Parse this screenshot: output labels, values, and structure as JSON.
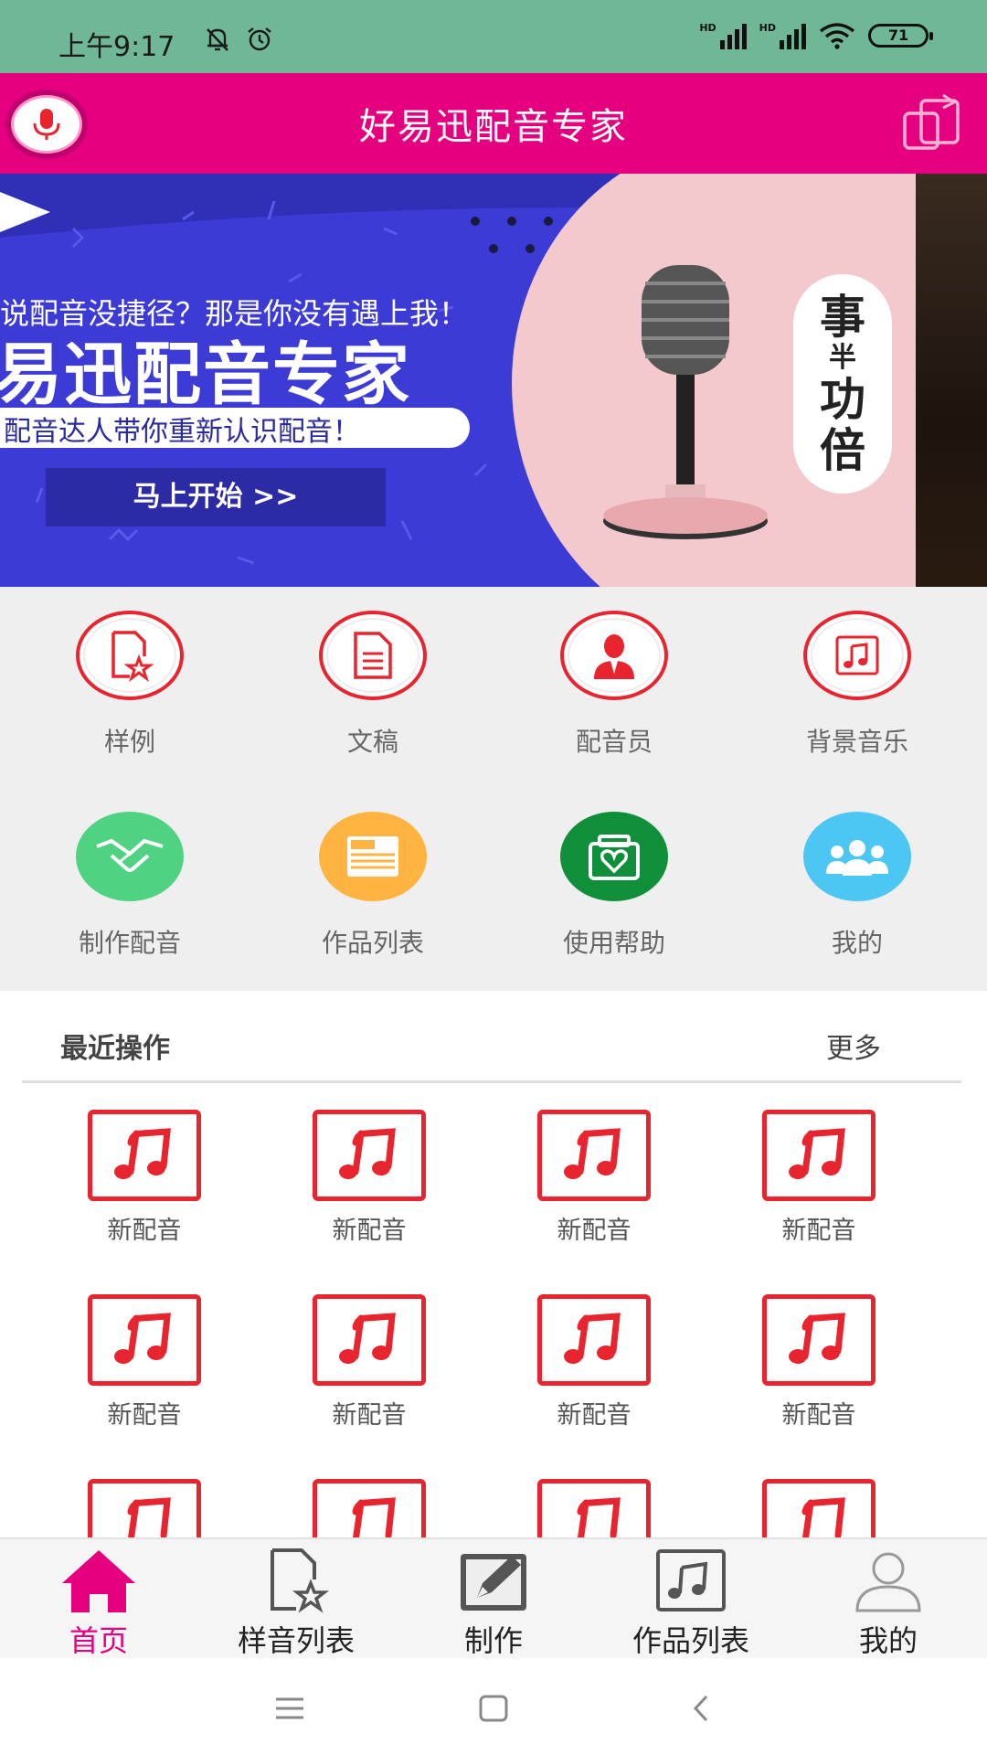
{
  "status_bar": {
    "time": "上午9:17",
    "battery": "71",
    "signal1_label": "HD",
    "signal2_label": "HD"
  },
  "app_bar": {
    "title": "好易迅配音专家"
  },
  "banner": {
    "line1": "说配音没捷径？那是你没有遇上我！",
    "line2": "易迅配音专家",
    "line3": "配音达人带你重新认识配音！",
    "cta": "马上开始 >>",
    "badge": [
      "事",
      "半",
      "功",
      "倍"
    ]
  },
  "menu": {
    "items": [
      {
        "label": "样例",
        "icon": "sample-doc-star-icon"
      },
      {
        "label": "文稿",
        "icon": "document-icon"
      },
      {
        "label": "配音员",
        "icon": "voice-actor-icon"
      },
      {
        "label": "背景音乐",
        "icon": "music-note-icon"
      },
      {
        "label": "制作配音",
        "icon": "handshake-icon",
        "color": "#4fd382"
      },
      {
        "label": "作品列表",
        "icon": "news-icon",
        "color": "#ffb341"
      },
      {
        "label": "使用帮助",
        "icon": "help-heart-icon",
        "color": "#0f8f3a"
      },
      {
        "label": "我的",
        "icon": "group-users-icon",
        "color": "#4cc6f3"
      }
    ]
  },
  "recent": {
    "title": "最近操作",
    "more": "更多",
    "items": [
      {
        "label": "新配音"
      },
      {
        "label": "新配音"
      },
      {
        "label": "新配音"
      },
      {
        "label": "新配音"
      },
      {
        "label": "新配音"
      },
      {
        "label": "新配音"
      },
      {
        "label": "新配音"
      },
      {
        "label": "新配音"
      },
      {
        "label": ""
      },
      {
        "label": ""
      },
      {
        "label": ""
      },
      {
        "label": ""
      }
    ]
  },
  "bottom_nav": {
    "items": [
      {
        "label": "首页",
        "icon": "home-icon",
        "active": true
      },
      {
        "label": "样音列表",
        "icon": "sample-list-icon",
        "active": false
      },
      {
        "label": "制作",
        "icon": "edit-icon",
        "active": false
      },
      {
        "label": "作品列表",
        "icon": "music-list-icon",
        "active": false
      },
      {
        "label": "我的",
        "icon": "user-icon",
        "active": false
      }
    ]
  },
  "colors": {
    "status_bar": "#6fb796",
    "app_bar": "#e4007f",
    "accent_red": "#e8242e",
    "banner_blue": "#3c3bd6"
  }
}
